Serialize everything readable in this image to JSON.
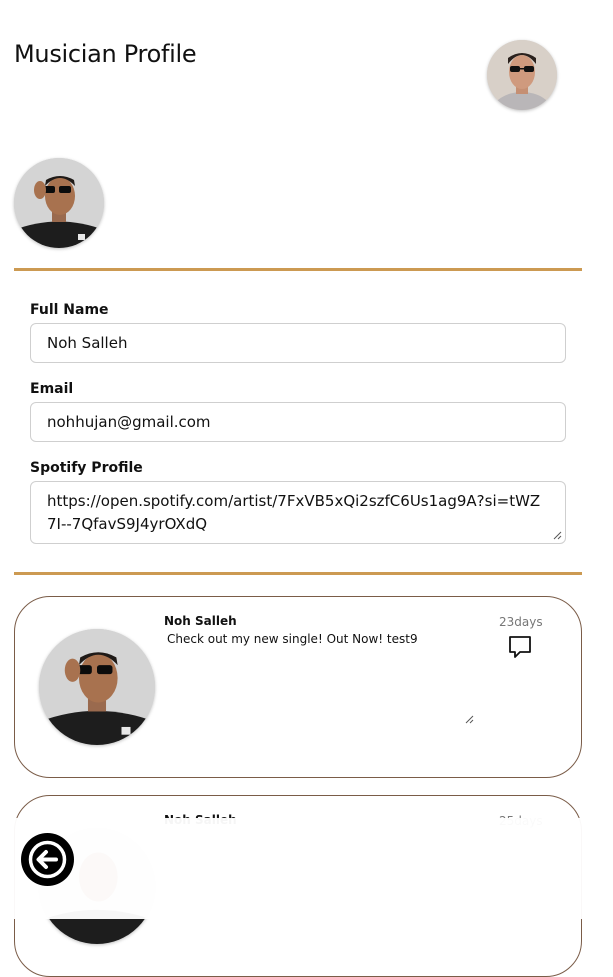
{
  "header": {
    "title": "Musician Profile"
  },
  "profile": {
    "full_name_label": "Full Name",
    "full_name_value": "Noh Salleh",
    "email_label": "Email",
    "email_value": "nohhujan@gmail.com",
    "spotify_label": "Spotify Profile",
    "spotify_value": "https://open.spotify.com/artist/7FxVB5xQi2szfC6Us1ag9A?si=tWZ7I--7QfavS9J4yrOXdQ"
  },
  "posts": [
    {
      "author": "Noh Salleh",
      "text": "Check out my new single! Out Now! test9",
      "time": "23days",
      "icon": "comment-icon"
    },
    {
      "author": "Noh Salleh",
      "text": "",
      "time": "25days",
      "icon": "comment-icon"
    }
  ],
  "icons": {
    "back": "arrow-left-circle-icon"
  },
  "colors": {
    "divider": "#cc9a52",
    "card_border": "#7a5c48",
    "back_button": "#000000"
  }
}
